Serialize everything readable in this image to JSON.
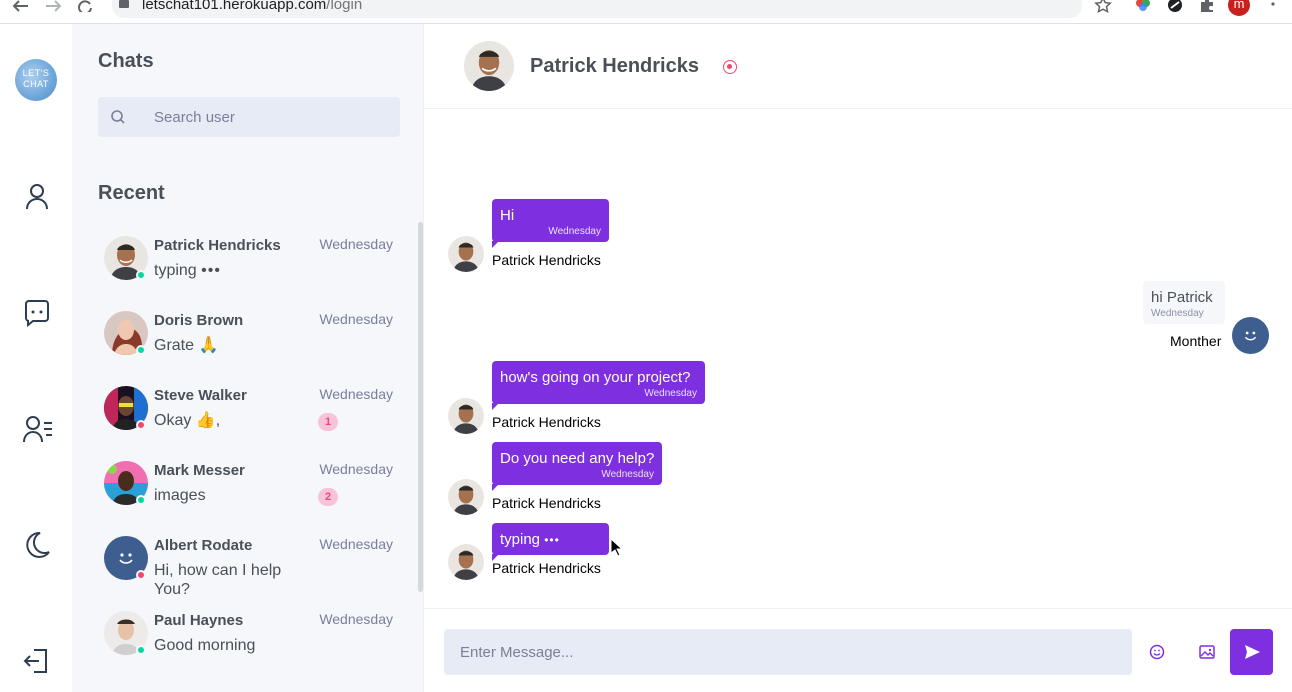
{
  "browser": {
    "url_host": "letschat101.herokuapp.com",
    "url_path": "/login",
    "profile_initial": "m"
  },
  "rail": {
    "logo_text_line1": "LET'S",
    "logo_text_line2": "CHAT",
    "icons": [
      "profile-icon",
      "chats-icon",
      "contacts-icon",
      "dark-mode-icon",
      "logout-icon"
    ]
  },
  "panel": {
    "title": "Chats",
    "search_placeholder": "Search user",
    "recent_title": "Recent"
  },
  "chats": [
    {
      "name": "Patrick Hendricks",
      "message": "typing",
      "time": "Wednesday",
      "status": "online",
      "typing": true
    },
    {
      "name": "Doris Brown",
      "message": "Grate 🙏",
      "time": "Wednesday",
      "status": "online"
    },
    {
      "name": "Steve Walker",
      "message": "Okay 👍,",
      "time": "Wednesday",
      "status": "offline",
      "unread": "1"
    },
    {
      "name": "Mark Messer",
      "message": "images",
      "time": "Wednesday",
      "status": "online",
      "unread": "2"
    },
    {
      "name": "Albert Rodate",
      "message": "Hi, how can I help You?",
      "time": "Wednesday",
      "status": "offline"
    },
    {
      "name": "Paul Haynes",
      "message": "Good morning",
      "time": "Wednesday",
      "status": "online"
    }
  ],
  "conversation": {
    "contact_name": "Patrick Hendricks",
    "messages": [
      {
        "text": "Hi",
        "time": "Wednesday",
        "sender": "Patrick Hendricks",
        "direction": "in"
      },
      {
        "text": "hi Patrick",
        "time": "Wednesday",
        "sender": "Monther",
        "direction": "out"
      },
      {
        "text": "how's going on your project?",
        "time": "Wednesday",
        "sender": "Patrick Hendricks",
        "direction": "in"
      },
      {
        "text": "Do you need any help?",
        "time": "Wednesday",
        "sender": "Patrick Hendricks",
        "direction": "in"
      },
      {
        "text": "typing",
        "time": "",
        "sender": "Patrick Hendricks",
        "direction": "in",
        "typing": true
      }
    ],
    "composer_placeholder": "Enter Message..."
  },
  "colors": {
    "accent": "#7e2fe0",
    "panel_bg": "#f5f7fb",
    "online": "#06d6a0",
    "offline": "#ef476f"
  }
}
